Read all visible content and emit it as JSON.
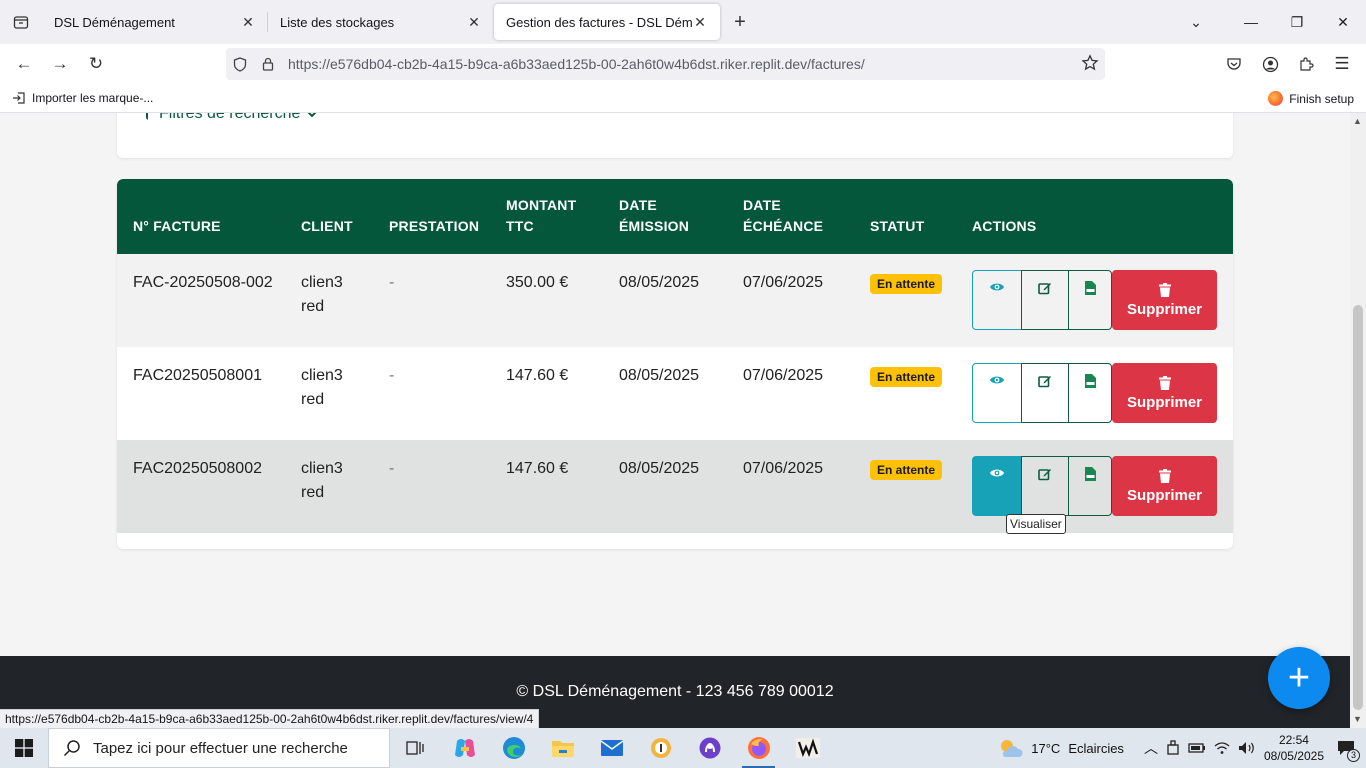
{
  "browser": {
    "tabs": [
      {
        "title": "DSL Déménagement",
        "active": false
      },
      {
        "title": "Liste des stockages",
        "active": false
      },
      {
        "title": "Gestion des factures - DSL Déménagement",
        "active": true
      }
    ],
    "url_prefix": "https://e576db04-cb2b-4a15-b9ca-a6b33aed125b-00-2ah6t0w4b6dst.riker.replit.dev",
    "url_path": "/factures/",
    "bookmark_import": "Importer les marque-...",
    "finish_setup": "Finish setup"
  },
  "filters": {
    "title": "Filtres de recherche"
  },
  "table": {
    "headers": {
      "invoice_no": "N° FACTURE",
      "client": "CLIENT",
      "service": "PRESTATION",
      "amount_1": "MONTANT",
      "amount_2": "TTC",
      "issue_1": "DATE",
      "issue_2": "ÉMISSION",
      "due_1": "DATE",
      "due_2": "ÉCHÉANCE",
      "status": "STATUT",
      "actions": "ACTIONS"
    },
    "rows": [
      {
        "invoice": "FAC-20250508-002",
        "client_1": "clien3",
        "client_2": "red",
        "service": "-",
        "amount": "350.00 €",
        "issued": "08/05/2025",
        "due": "07/06/2025",
        "status": "En attente",
        "delete": "Supprimer"
      },
      {
        "invoice": "FAC20250508001",
        "client_1": "clien3",
        "client_2": "red",
        "service": "-",
        "amount": "147.60 €",
        "issued": "08/05/2025",
        "due": "07/06/2025",
        "status": "En attente",
        "delete": "Supprimer"
      },
      {
        "invoice": "FAC20250508002",
        "client_1": "clien3",
        "client_2": "red",
        "service": "-",
        "amount": "147.60 €",
        "issued": "08/05/2025",
        "due": "07/06/2025",
        "status": "En attente",
        "delete": "Supprimer"
      }
    ],
    "tooltip": "Visualiser"
  },
  "footer": {
    "text": "© DSL Déménagement - 123 456 789 00012"
  },
  "status_url": "https://e576db04-cb2b-4a15-b9ca-a6b33aed125b-00-2ah6t0w4b6dst.riker.replit.dev/factures/view/4",
  "taskbar": {
    "search_placeholder": "Tapez ici pour effectuer une recherche",
    "weather_temp": "17°C",
    "weather_desc": "Eclaircies",
    "time": "22:54",
    "date": "08/05/2025",
    "notifications": "3"
  },
  "colors": {
    "header_green": "#04573a",
    "badge_yellow": "#ffc107",
    "danger_red": "#dc3545",
    "info_cyan": "#17a2b8",
    "fab_blue": "#0d8af0"
  }
}
